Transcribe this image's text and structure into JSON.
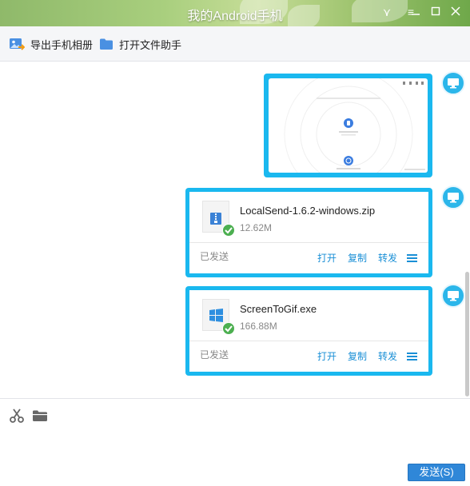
{
  "window": {
    "title": "我的Android手机",
    "controls": [
      {
        "name": "collapse-icon",
        "glyph": "⋎"
      },
      {
        "name": "menu-icon",
        "glyph": "≡"
      },
      {
        "name": "minimize-icon",
        "glyph": "—"
      },
      {
        "name": "maximize-icon",
        "glyph": "☐"
      },
      {
        "name": "close-icon",
        "glyph": "✕"
      }
    ]
  },
  "toolbar": {
    "export_album_label": "导出手机相册",
    "open_assistant_label": "打开文件助手"
  },
  "messages": [
    {
      "type": "image",
      "sender_icon": "monitor-icon"
    },
    {
      "type": "file",
      "name": "LocalSend-1.6.2-windows.zip",
      "size": "12.62M",
      "status": "已发送",
      "file_icon": "zip-icon",
      "actions": [
        "打开",
        "复制",
        "转发"
      ]
    },
    {
      "type": "file",
      "name": "ScreenToGif.exe",
      "size": "166.88M",
      "status": "已发送",
      "file_icon": "windows-icon",
      "actions": [
        "打开",
        "复制",
        "转发"
      ]
    }
  ],
  "input": {
    "send_label": "发送(S)",
    "tools": [
      "scissors-icon",
      "folder-icon"
    ]
  },
  "colors": {
    "accent": "#1ab8ef",
    "link": "#1a8fd6",
    "send_button": "#2f87d8",
    "success": "#4caf50"
  }
}
